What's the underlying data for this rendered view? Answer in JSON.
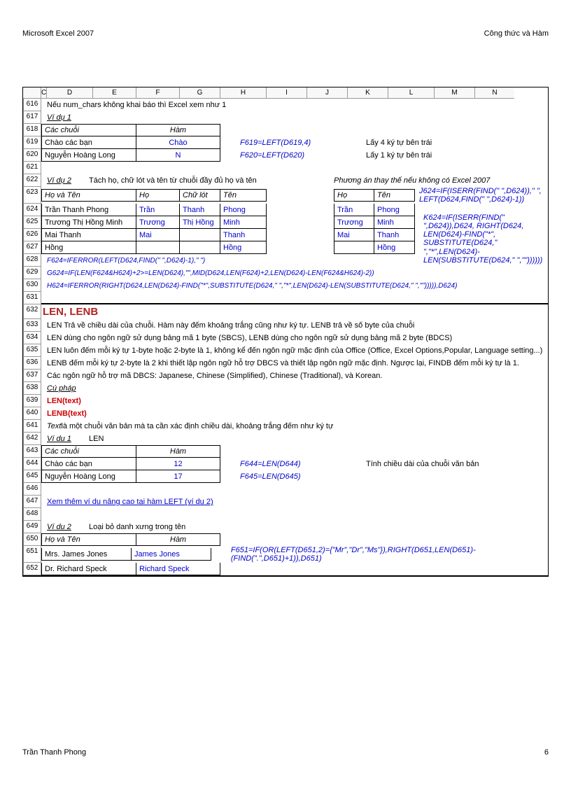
{
  "header": {
    "left": "Microsoft Excel 2007",
    "right": "Công thức và Hàm"
  },
  "footer": {
    "left": "Trần Thanh Phong",
    "right": "6"
  },
  "cols": [
    "C",
    "D",
    "E",
    "F",
    "G",
    "H",
    "I",
    "J",
    "K",
    "L",
    "M",
    "N"
  ],
  "r616": "Nếu num_chars không khai báo thì Excel xem như 1",
  "r617": "Ví dụ 1",
  "r618": {
    "a": "Các chuỗi",
    "b": "Hàm"
  },
  "r619": {
    "a": "Chào các bạn",
    "b": "Chào",
    "c": "F619=LEFT(D619,4)",
    "d": "Lấy 4 ký tự bên trái"
  },
  "r620": {
    "a": "Nguyễn Hoàng Long",
    "b": "N",
    "c": "F620=LEFT(D620)",
    "d": "Lấy 1 ký tự bên trái"
  },
  "r622": {
    "a": "Ví dụ 2",
    "b": "Tách họ, chữ lót và tên từ chuỗi đầy đủ họ và tên",
    "c": "Phương án thay thế nếu không có Excel 2007"
  },
  "r623": {
    "a": "Họ và Tên",
    "b": "Họ",
    "c": "Chữ lót",
    "d": "Tên",
    "e": "Họ",
    "f": "Tên",
    "g": "J624=IF(ISERR(FIND(\" \",D624)),\" \", LEFT(D624,FIND(\" \",D624)-1))"
  },
  "r624": {
    "a": "Trần Thanh Phong",
    "b": "Trần",
    "c": "Thanh",
    "d": "Phong",
    "e": "Trần",
    "f": "Phong"
  },
  "r625": {
    "a": "Trương Thị Hồng Minh",
    "b": "Trương",
    "c": "Thị Hồng",
    "d": "Minh",
    "e": "Trương",
    "f": "Minh",
    "g": "K624=IF(ISERR(FIND(\" \",D624)),D624, RIGHT(D624, LEN(D624)-FIND(\"*\", SUBSTITUTE(D624,\" \",\"*\",LEN(D624)- LEN(SUBSTITUTE(D624,\" \",\"\"))))))"
  },
  "r626": {
    "a": "Mai Thanh",
    "b": "Mai",
    "d": "Thanh",
    "e": "Mai",
    "f": "Thanh"
  },
  "r627": {
    "a": "Hồng",
    "d": "Hồng",
    "f": "Hồng"
  },
  "r628": "F624=IFERROR(LEFT(D624,FIND(\" \",D624)-1),\" \")",
  "r629": "G624=IF(LEN(F624&H624)+2>=LEN(D624),\"\",MID(D624,LEN(F624)+2,LEN(D624)-LEN(F624&H624)-2))",
  "r630": "H624=IFERROR(RIGHT(D624,LEN(D624)-FIND(\"*\",SUBSTITUTE(D624,\" \",\"*\",LEN(D624)-LEN(SUBSTITUTE(D624,\" \",\"\"))))),D624)",
  "r632": "LEN, LENB",
  "r633": "LEN Trả về chiều dài của chuỗi. Hàm này đếm khoảng trắng cũng như ký tự. LENB trả về số byte của chuỗi",
  "r634": "LEN dùng cho ngôn ngữ sử dụng bảng mã 1 byte (SBCS), LENB dùng cho ngôn ngữ sử dụng bảng mã 2 byte (BDCS)",
  "r635": "LEN luôn đếm mỗi ký tự 1-byte hoặc 2-byte là 1, không kể đến ngôn ngữ mặc định của Office (Office, Excel Options,Popular, Language setting...)",
  "r636": "LENB đếm mỗi ký tự 2-byte là 2 khi thiết lập ngôn ngữ hỗ trợ DBCS và thiết lập ngôn ngữ mặc định. Ngược lại, FINDB đếm mỗi ký tự là 1.",
  "r637": "Các ngôn ngữ hỗ trợ mã DBCS: Japanese, Chinese (Simplified), Chinese (Traditional), và Korean.",
  "r638": "Cú pháp",
  "r639": "LEN(text)",
  "r640": "LENB(text)",
  "r641a": "Text",
  "r641b": " là một chuỗi văn bản mà ta cần xác định chiều dài, khoảng trắng đếm như ký tự",
  "r642": {
    "a": "Ví dụ 1",
    "b": "LEN"
  },
  "r643": {
    "a": "Các chuỗi",
    "b": "Hàm"
  },
  "r644": {
    "a": "Chào các bạn",
    "b": "12",
    "c": "F644=LEN(D644)",
    "d": "Tính chiều dài của chuỗi văn bản"
  },
  "r645": {
    "a": "Nguyễn Hoàng Long",
    "b": "17",
    "c": "F645=LEN(D645)"
  },
  "r647": "Xem thêm ví dụ nâng cao tại hàm LEFT (ví dụ 2)",
  "r649": {
    "a": "Ví dụ 2",
    "b": "Loại bỏ danh xưng trong tên"
  },
  "r650": {
    "a": "Họ và Tên",
    "b": "Hàm"
  },
  "r651": {
    "a": "Mrs. James Jones",
    "b": "James Jones",
    "c": "F651=IF(OR(LEFT(D651,2)={\"Mr\",\"Dr\",\"Ms\"}),RIGHT(D651,LEN(D651)-(FIND(\".\",D651)+1)),D651)"
  },
  "r652": {
    "a": "Dr. Richard Speck",
    "b": "Richard Speck"
  }
}
